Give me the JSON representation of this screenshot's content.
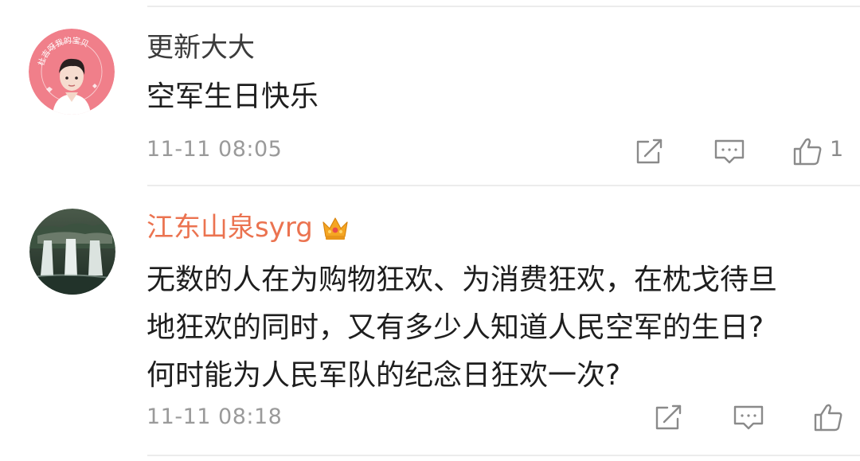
{
  "comments": [
    {
      "username": "更新大大",
      "avatar_text": "杜吉呀我的宝贝",
      "content_lines": [
        "空军生日快乐"
      ],
      "timestamp": "11-11 08:05",
      "likes": "1",
      "icons": [
        "repost-icon",
        "reply-icon",
        "like-icon"
      ]
    },
    {
      "username": "江东山泉syrg",
      "badge": "crown-icon",
      "content_lines": [
        "无数的人在为购物狂欢、为消费狂欢，在枕戈待旦",
        "地狂欢的同时，又有多少人知道人民空军的生日?",
        "何时能为人民军队的纪念日狂欢一次?"
      ],
      "timestamp": "11-11 08:18",
      "likes": "",
      "icons": [
        "repost-icon",
        "reply-icon",
        "like-icon"
      ]
    }
  ],
  "colors": {
    "username_default": "#3b3b3b",
    "username_member": "#eb7350",
    "text": "#1e1e1e",
    "meta": "#9a9a9a",
    "icon": "#8a8a8a",
    "divider": "#ececec",
    "avatar_pink": "#f07f8a"
  }
}
